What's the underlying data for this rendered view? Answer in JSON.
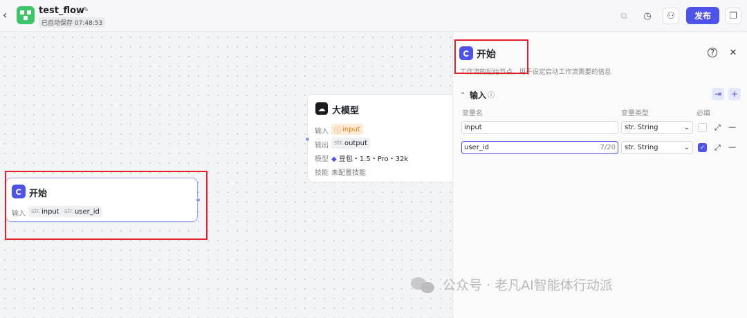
{
  "header": {
    "back_icon": "chevron-left-icon",
    "app_title": "test_flow",
    "autosave": "已自动保存 07:48:53",
    "publish_label": "发布"
  },
  "canvas": {
    "start_node": {
      "title": "开始",
      "input_label": "输入",
      "inputs": [
        {
          "type_prefix": "str.",
          "name": "input"
        },
        {
          "type_prefix": "str.",
          "name": "user_id"
        }
      ]
    },
    "llm_node": {
      "title": "大模型",
      "input_label": "输入",
      "input_value": "input",
      "output_label": "输出",
      "output_prefix": "str.",
      "output_value": "output",
      "model_label": "模型",
      "model_value": "豆包・1.5・Pro・32k",
      "skill_label": "技能",
      "skill_value": "未配置技能"
    }
  },
  "panel": {
    "title": "开始",
    "description": "工作流的起始节点，用于设定启动工作流需要的信息",
    "section_title": "输入",
    "columns": {
      "name": "变量名",
      "type": "变量类型",
      "required": "必填"
    },
    "rows": [
      {
        "name": "input",
        "type": "str. String",
        "required": false,
        "counter": ""
      },
      {
        "name": "user_id",
        "type": "str. String",
        "required": true,
        "counter": "7/20"
      }
    ]
  },
  "watermark": "公众号 · 老凡AI智能体行动派",
  "colors": {
    "accent": "#4d53e8",
    "highlight": "#e3202a",
    "app_icon": "#3ec56b"
  }
}
